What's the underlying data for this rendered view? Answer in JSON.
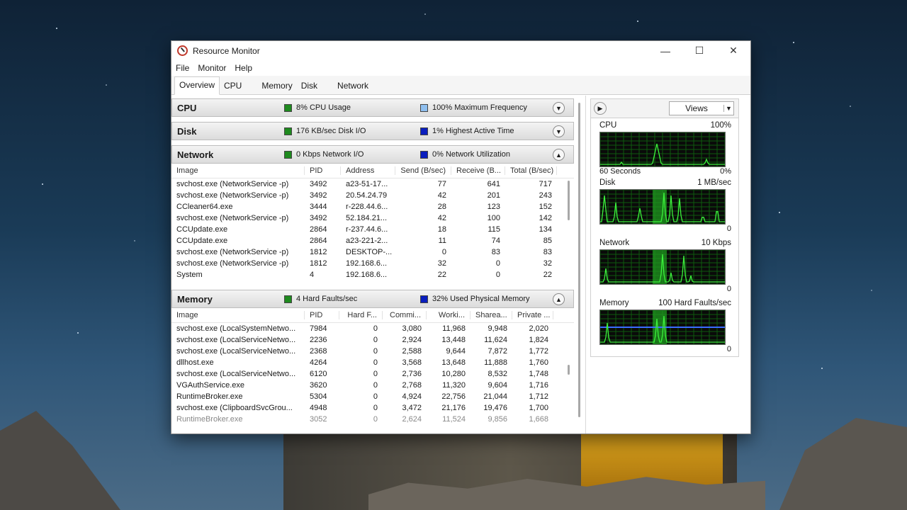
{
  "window": {
    "title": "Resource Monitor",
    "minimize": "—",
    "maximize": "☐",
    "close": "✕"
  },
  "menu": [
    "File",
    "Monitor",
    "Help"
  ],
  "tabs": [
    "Overview",
    "CPU",
    "Memory",
    "Disk",
    "Network"
  ],
  "sections": {
    "cpu": {
      "name": "CPU",
      "stat1": "8% CPU Usage",
      "stat1_color": "#1e8a1e",
      "stat2": "100% Maximum Frequency",
      "stat2_color": "#8fbfef"
    },
    "disk": {
      "name": "Disk",
      "stat1": "176 KB/sec Disk I/O",
      "stat1_color": "#1e8a1e",
      "stat2": "1% Highest Active Time",
      "stat2_color": "#0a1ebe"
    },
    "network": {
      "name": "Network",
      "stat1": "0 Kbps Network I/O",
      "stat1_color": "#1e8a1e",
      "stat2": "0% Network Utilization",
      "stat2_color": "#0a1ebe"
    },
    "memory": {
      "name": "Memory",
      "stat1": "4 Hard Faults/sec",
      "stat1_color": "#1e8a1e",
      "stat2": "32% Used Physical Memory",
      "stat2_color": "#0a1ebe"
    }
  },
  "network_table": {
    "columns": [
      "Image",
      "PID",
      "Address",
      "Send (B/sec)",
      "Receive (B...",
      "Total (B/sec)"
    ],
    "rows": [
      [
        "svchost.exe (NetworkService -p)",
        "3492",
        "a23-51-17...",
        "77",
        "641",
        "717"
      ],
      [
        "svchost.exe (NetworkService -p)",
        "3492",
        "20.54.24.79",
        "42",
        "201",
        "243"
      ],
      [
        "CCleaner64.exe",
        "3444",
        "r-228.44.6...",
        "28",
        "123",
        "152"
      ],
      [
        "svchost.exe (NetworkService -p)",
        "3492",
        "52.184.21...",
        "42",
        "100",
        "142"
      ],
      [
        "CCUpdate.exe",
        "2864",
        "r-237.44.6...",
        "18",
        "115",
        "134"
      ],
      [
        "CCUpdate.exe",
        "2864",
        "a23-221-2...",
        "11",
        "74",
        "85"
      ],
      [
        "svchost.exe (NetworkService -p)",
        "1812",
        "DESKTOP-...",
        "0",
        "83",
        "83"
      ],
      [
        "svchost.exe (NetworkService -p)",
        "1812",
        "192.168.6...",
        "32",
        "0",
        "32"
      ],
      [
        "System",
        "4",
        "192.168.6...",
        "22",
        "0",
        "22"
      ]
    ]
  },
  "memory_table": {
    "columns": [
      "Image",
      "PID",
      "Hard F...",
      "Commi...",
      "Worki...",
      "Sharea...",
      "Private ..."
    ],
    "rows": [
      [
        "svchost.exe (LocalSystemNetwo...",
        "7984",
        "0",
        "3,080",
        "11,968",
        "9,948",
        "2,020"
      ],
      [
        "svchost.exe (LocalServiceNetwo...",
        "2236",
        "0",
        "2,924",
        "13,448",
        "11,624",
        "1,824"
      ],
      [
        "svchost.exe (LocalServiceNetwo...",
        "2368",
        "0",
        "2,588",
        "9,644",
        "7,872",
        "1,772"
      ],
      [
        "dllhost.exe",
        "4264",
        "0",
        "3,568",
        "13,648",
        "11,888",
        "1,760"
      ],
      [
        "svchost.exe (LocalServiceNetwo...",
        "6120",
        "0",
        "2,736",
        "10,280",
        "8,532",
        "1,748"
      ],
      [
        "VGAuthService.exe",
        "3620",
        "0",
        "2,768",
        "11,320",
        "9,604",
        "1,716"
      ],
      [
        "RuntimeBroker.exe",
        "5304",
        "0",
        "4,924",
        "22,756",
        "21,044",
        "1,712"
      ],
      [
        "svchost.exe (ClipboardSvcGrou...",
        "4948",
        "0",
        "3,472",
        "21,176",
        "19,476",
        "1,700"
      ],
      [
        "RuntimeBroker.exe",
        "3052",
        "0",
        "2,624",
        "11,524",
        "9,856",
        "1,668"
      ]
    ]
  },
  "right_panel": {
    "views_label": "Views",
    "cpu": {
      "label": "CPU",
      "max": "100%",
      "footer_left": "60 Seconds",
      "footer_right": "0%"
    },
    "disk": {
      "label": "Disk",
      "max": "1 MB/sec",
      "footer_right": "0"
    },
    "network": {
      "label": "Network",
      "max": "10 Kbps",
      "footer_right": "0"
    },
    "memory": {
      "label": "Memory",
      "max": "100 Hard Faults/sec",
      "footer_right": "0"
    }
  }
}
